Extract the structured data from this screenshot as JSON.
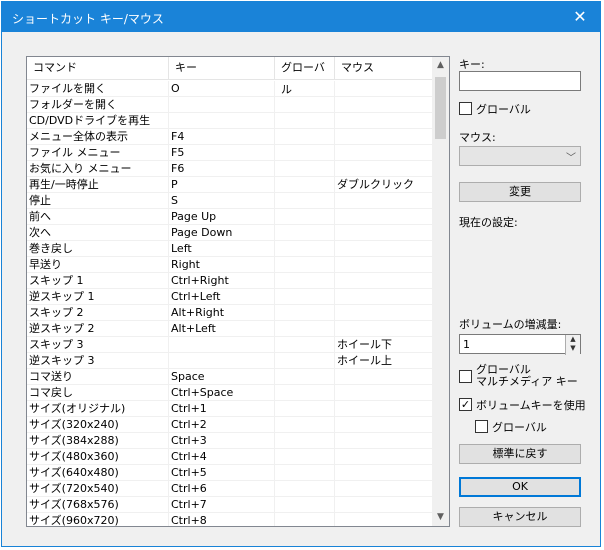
{
  "window": {
    "title": "ショートカット キー/マウス",
    "close_glyph": "✕"
  },
  "list": {
    "columns": [
      "コマンド",
      "キー",
      "グローバル",
      "マウス"
    ],
    "rows": [
      [
        "ファイルを開く",
        "O",
        "",
        ""
      ],
      [
        "フォルダーを開く",
        "",
        "",
        ""
      ],
      [
        "CD/DVDドライブを再生",
        "",
        "",
        ""
      ],
      [
        "メニュー全体の表示",
        "F4",
        "",
        ""
      ],
      [
        "ファイル メニュー",
        "F5",
        "",
        ""
      ],
      [
        "お気に入り メニュー",
        "F6",
        "",
        ""
      ],
      [
        "再生/一時停止",
        "P",
        "",
        "ダブルクリック"
      ],
      [
        "停止",
        "S",
        "",
        ""
      ],
      [
        "前へ",
        "Page Up",
        "",
        ""
      ],
      [
        "次へ",
        "Page Down",
        "",
        ""
      ],
      [
        "巻き戻し",
        "Left",
        "",
        ""
      ],
      [
        "早送り",
        "Right",
        "",
        ""
      ],
      [
        "スキップ 1",
        "Ctrl+Right",
        "",
        ""
      ],
      [
        "逆スキップ 1",
        "Ctrl+Left",
        "",
        ""
      ],
      [
        "スキップ 2",
        "Alt+Right",
        "",
        ""
      ],
      [
        "逆スキップ 2",
        "Alt+Left",
        "",
        ""
      ],
      [
        "スキップ 3",
        "",
        "",
        "ホイール下"
      ],
      [
        "逆スキップ 3",
        "",
        "",
        "ホイール上"
      ],
      [
        "コマ送り",
        "Space",
        "",
        ""
      ],
      [
        "コマ戻し",
        "Ctrl+Space",
        "",
        ""
      ],
      [
        "サイズ(オリジナル)",
        "Ctrl+1",
        "",
        ""
      ],
      [
        "サイズ(320x240)",
        "Ctrl+2",
        "",
        ""
      ],
      [
        "サイズ(384x288)",
        "Ctrl+3",
        "",
        ""
      ],
      [
        "サイズ(480x360)",
        "Ctrl+4",
        "",
        ""
      ],
      [
        "サイズ(640x480)",
        "Ctrl+5",
        "",
        ""
      ],
      [
        "サイズ(720x540)",
        "Ctrl+6",
        "",
        ""
      ],
      [
        "サイズ(768x576)",
        "Ctrl+7",
        "",
        ""
      ],
      [
        "サイズ(960x720)",
        "Ctrl+8",
        "",
        ""
      ]
    ]
  },
  "right_panel": {
    "key_label": "キー:",
    "key_value": "",
    "global_check_label": "グローバル",
    "global_checked": false,
    "mouse_label": "マウス:",
    "mouse_value": "",
    "change_button": "変更",
    "current_setting_label": "現在の設定:",
    "volume_step_label": "ボリュームの増減量:",
    "volume_step_value": "1",
    "global_multimedia_label_line1": "グローバル",
    "global_multimedia_label_line2": "マルチメディア キー",
    "global_multimedia_checked": false,
    "use_volume_keys_label": "ボリュームキーを使用",
    "use_volume_keys_checked": true,
    "volume_global_label": "グローバル",
    "volume_global_checked": false,
    "reset_button": "標準に戻す",
    "ok_button": "OK",
    "cancel_button": "キャンセル"
  }
}
